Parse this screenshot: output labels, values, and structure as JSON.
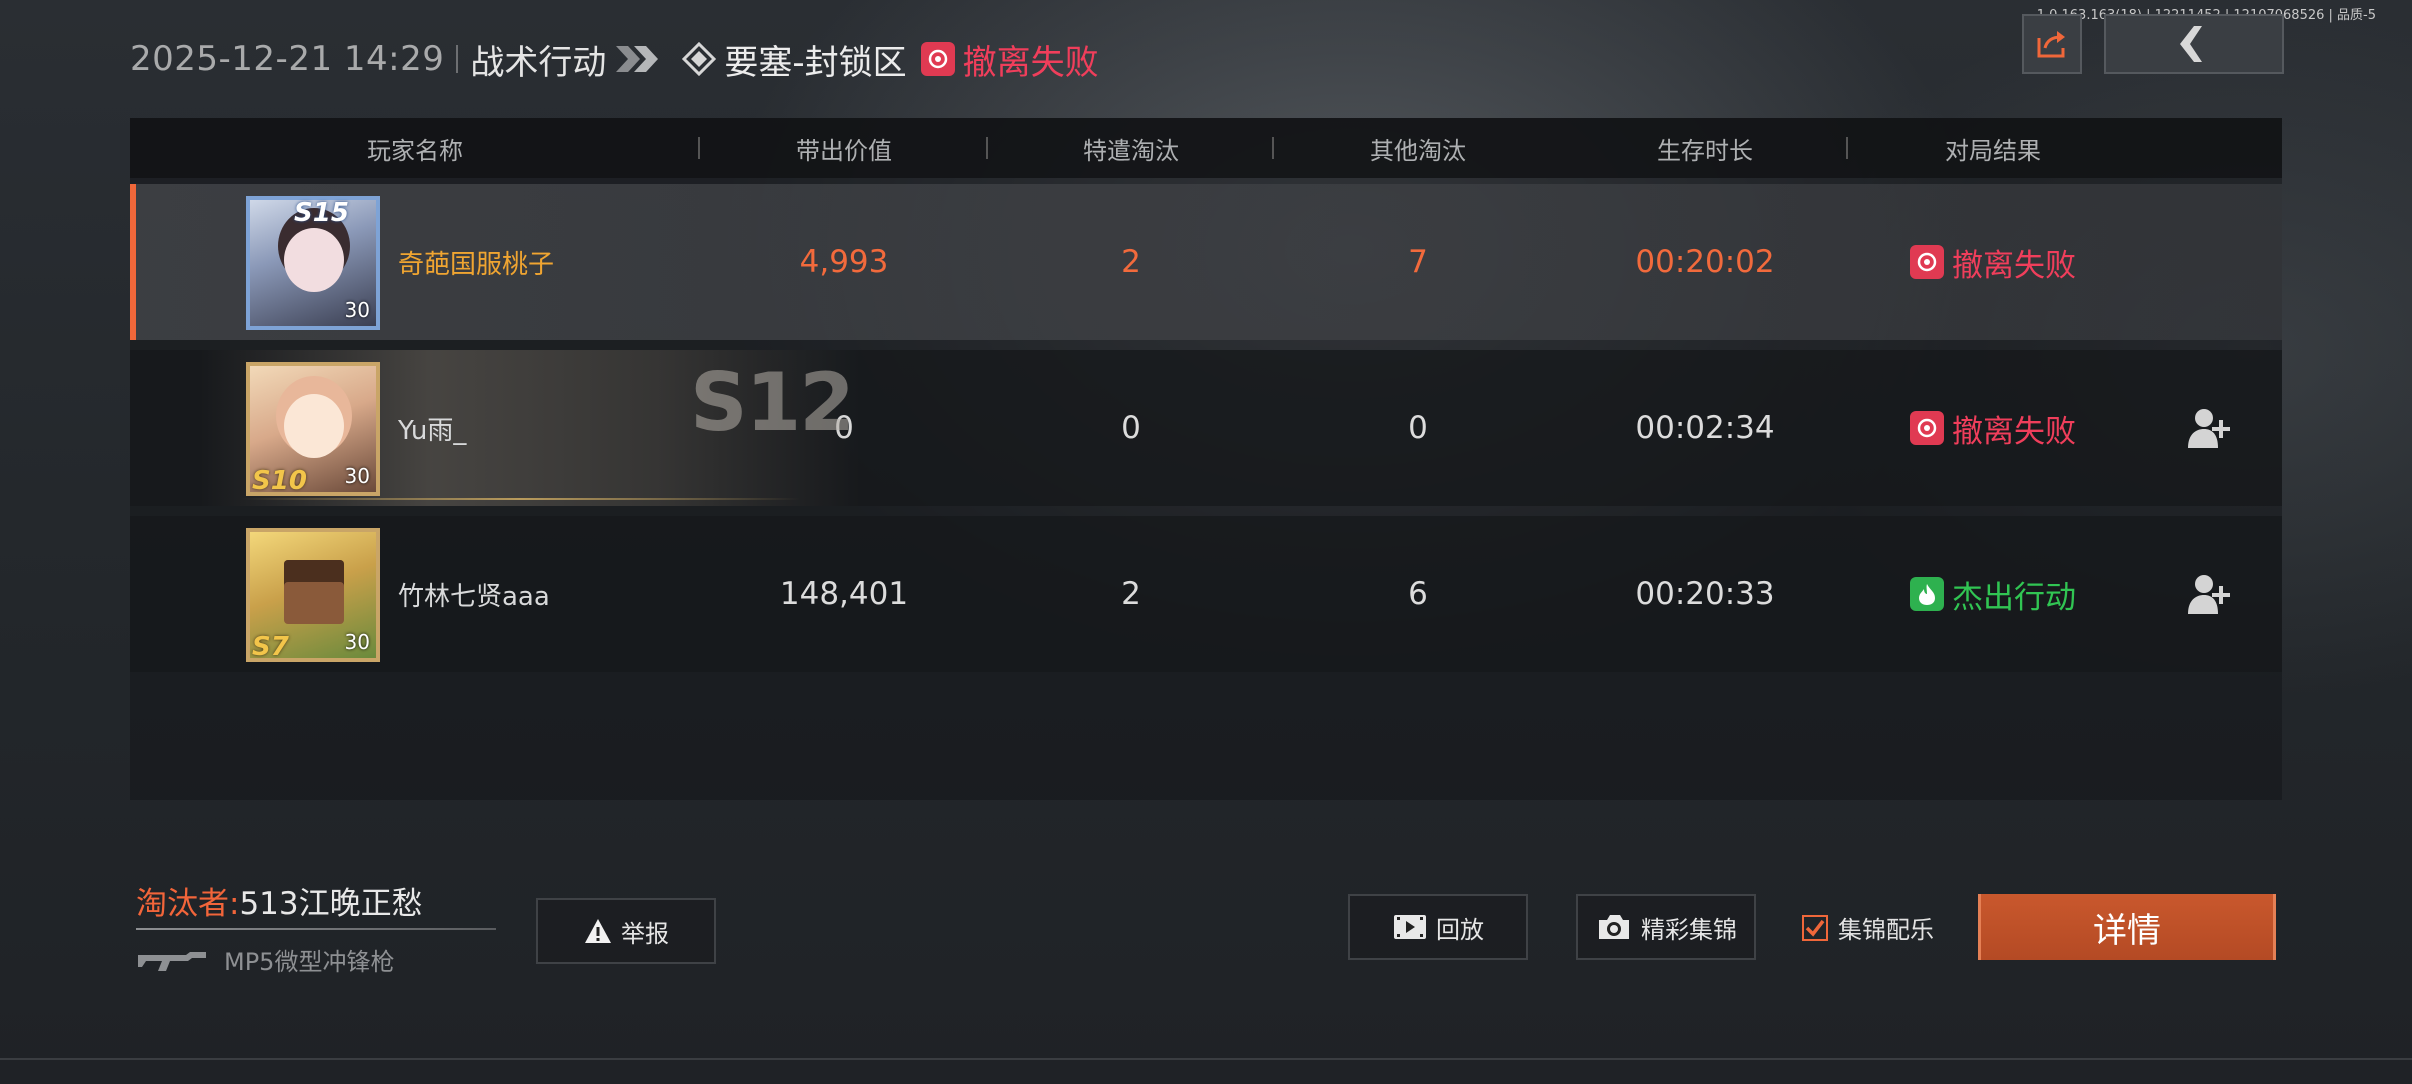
{
  "version": "1.0.163.163(18) | 12211452 | 12107068526 | 品质-5",
  "header": {
    "datetime": "2025-12-21 14:29",
    "mode": "战术行动",
    "map": "要塞-封锁区",
    "result": "撤离失败"
  },
  "table": {
    "headers": [
      "玩家名称",
      "带出价值",
      "特遣淘汰",
      "其他淘汰",
      "生存时长",
      "对局结果"
    ],
    "rows": [
      {
        "name": "奇葩国服桃子",
        "season": "S15",
        "level": "30",
        "value": "4,993",
        "ops_kills": "2",
        "other_kills": "7",
        "survival": "00:20:02",
        "result": "撤离失败",
        "result_color": "#f03e5b"
      },
      {
        "name": "Yu雨_",
        "season": "S10",
        "level": "30",
        "banner": "S12",
        "value": "0",
        "ops_kills": "0",
        "other_kills": "0",
        "survival": "00:02:34",
        "result": "撤离失败",
        "result_color": "#f03e5b"
      },
      {
        "name": "竹林七贤aaa",
        "season": "S7",
        "level": "30",
        "value": "148,401",
        "ops_kills": "2",
        "other_kills": "6",
        "survival": "00:20:33",
        "result": "杰出行动",
        "result_color": "#31c553"
      }
    ]
  },
  "killer": {
    "label": "淘汰者:",
    "name": "513江晚正愁",
    "weapon": "MP5微型冲锋枪"
  },
  "buttons": {
    "report": "举报",
    "replay": "回放",
    "highlights": "精彩集锦",
    "music": "集锦配乐",
    "details": "详情"
  },
  "colors": {
    "accent": "#f0673a",
    "fail": "#f03e5b",
    "success": "#31c553",
    "self_name": "#f0a531"
  }
}
